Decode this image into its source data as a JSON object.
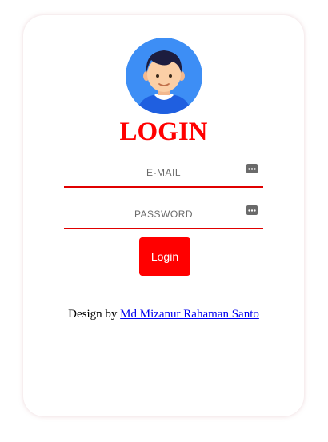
{
  "login": {
    "title": "LOGIN",
    "email": {
      "placeholder": "E-MAIL",
      "value": ""
    },
    "password": {
      "placeholder": "PASSWORD",
      "value": ""
    },
    "submit_label": "Login"
  },
  "footer": {
    "prefix": "Design by ",
    "author_link": "Md Mizanur Rahaman Santo"
  },
  "icons": {
    "avatar": "user-avatar-icon",
    "email_field": "password-dots-icon",
    "password_field": "password-dots-icon"
  },
  "colors": {
    "accent": "#ff0000",
    "underline": "#e00000",
    "link": "#0000ee",
    "avatar_bg": "#3d8ef5"
  }
}
